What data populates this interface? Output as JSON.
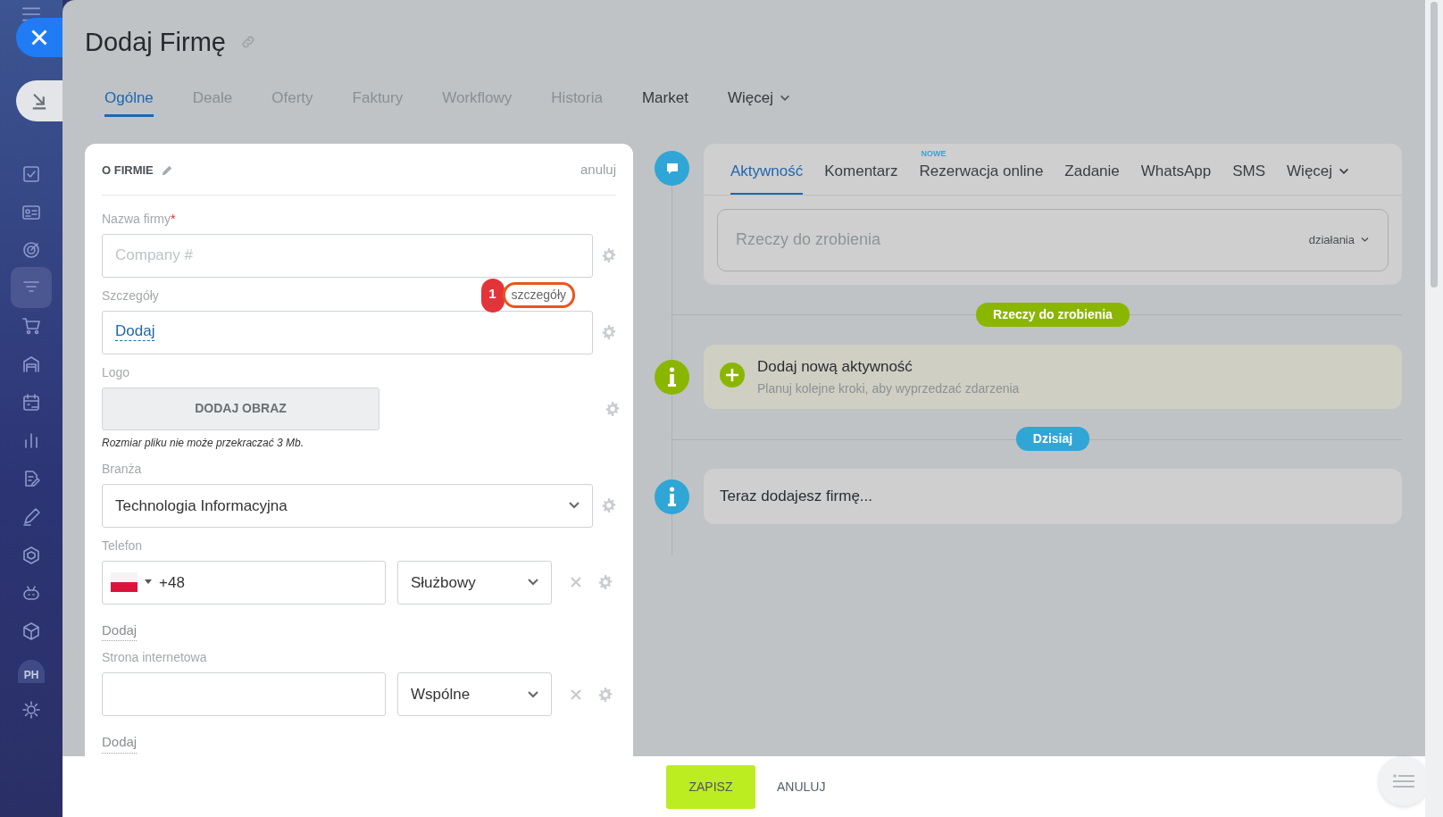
{
  "sidebar": {
    "avatar": "PH"
  },
  "header": {
    "title": "Dodaj Firmę"
  },
  "tabs": [
    {
      "label": "Ogólne",
      "selected": true,
      "kind": "tab"
    },
    {
      "label": "Deale",
      "selected": false,
      "kind": "tab"
    },
    {
      "label": "Oferty",
      "selected": false,
      "kind": "tab"
    },
    {
      "label": "Faktury",
      "selected": false,
      "kind": "tab"
    },
    {
      "label": "Workflowy",
      "selected": false,
      "kind": "tab"
    },
    {
      "label": "Historia",
      "selected": false,
      "kind": "tab"
    },
    {
      "label": "Market",
      "selected": false,
      "kind": "app"
    },
    {
      "label": "Więcej",
      "selected": false,
      "kind": "menu"
    }
  ],
  "form": {
    "title": "O FIRMIE",
    "cancel": "anuluj",
    "fields": [
      {
        "kind": "text",
        "label": "Nazwa firmy",
        "required_mark": "*",
        "placeholder": "Company #"
      },
      {
        "kind": "link",
        "label": "Szczegóły",
        "value": "Dodaj",
        "annotation": {
          "number": "1",
          "text": "szczegóły"
        }
      },
      {
        "kind": "image",
        "label": "Logo",
        "button": "DODAJ OBRAZ",
        "hint": "Rozmiar pliku nie może przekraczać 3 Mb."
      },
      {
        "kind": "select",
        "label": "Branża",
        "value": "Technologia Informacyjna"
      },
      {
        "kind": "multi",
        "label": "Telefon",
        "value": "+48",
        "flag": true,
        "type": "Służbowy",
        "add": "Dodaj"
      },
      {
        "kind": "multi",
        "label": "Strona internetowa",
        "flag": false,
        "type": "Wspólne",
        "add": "Dodaj"
      }
    ]
  },
  "timeline": {
    "tabs": [
      {
        "label": "Aktywność",
        "selected": true,
        "kind": "tab"
      },
      {
        "label": "Komentarz",
        "selected": false,
        "kind": "tab"
      },
      {
        "label": "Rezerwacja online",
        "selected": false,
        "kind": "tab",
        "badge": "NOWE"
      },
      {
        "label": "Zadanie",
        "selected": false,
        "kind": "tab"
      },
      {
        "label": "WhatsApp",
        "selected": false,
        "kind": "tab"
      },
      {
        "label": "SMS",
        "selected": false,
        "kind": "tab"
      },
      {
        "label": "Więcej",
        "selected": false,
        "kind": "menu"
      }
    ],
    "input": {
      "placeholder": "Rzeczy do zrobienia",
      "actions": "działania"
    },
    "sections": [
      {
        "badge": "Rzeczy do zrobienia",
        "color": "#8bb600",
        "title": "Dodaj nową aktywność",
        "subtitle": "Planuj kolejne kroki, aby wyprzedzać zdarzenia",
        "kind": "add"
      },
      {
        "badge": "Dzisiaj",
        "color": "#2fa6d6",
        "title": "Teraz dodajesz firmę...",
        "kind": "info"
      }
    ]
  },
  "footer": {
    "save": "ZAPISZ",
    "cancel": "ANULUJ"
  }
}
